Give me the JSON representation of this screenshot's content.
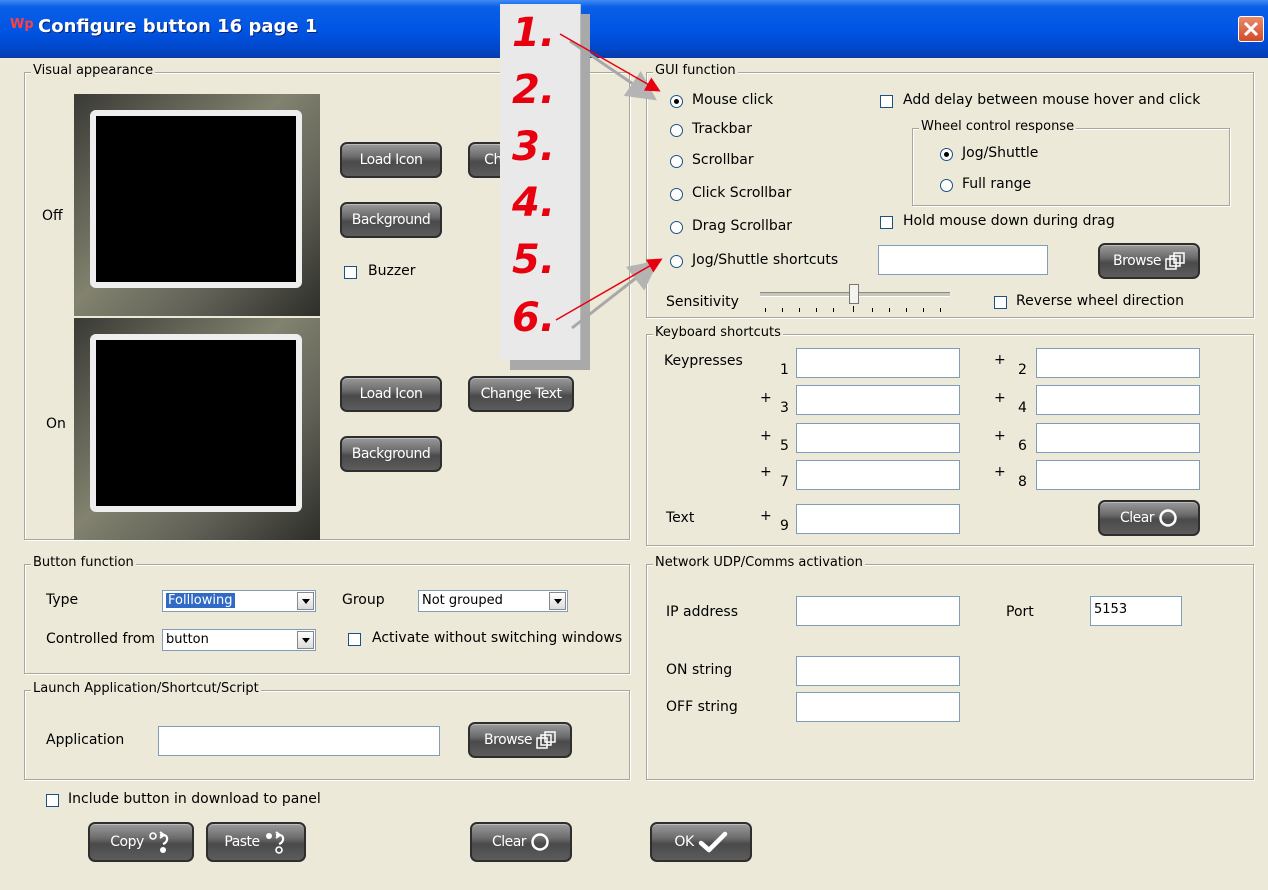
{
  "window": {
    "title": "Configure button 16 page 1",
    "app_icon": "Wp"
  },
  "annotations": [
    "1.",
    "2.",
    "3.",
    "4.",
    "5.",
    "6."
  ],
  "visual_appearance": {
    "label": "Visual appearance",
    "off_label": "Off",
    "on_label": "On",
    "load_icon_label": "Load Icon",
    "change_text_label": "Change Text",
    "change_text_partial": "Ch",
    "background_label": "Background",
    "buzzer_label": "Buzzer"
  },
  "gui_function": {
    "label": "GUI function",
    "options": [
      "Mouse click",
      "Trackbar",
      "Scrollbar",
      "Click Scrollbar",
      "Drag Scrollbar",
      "Jog/Shuttle shortcuts"
    ],
    "selected": "Mouse click",
    "add_delay_label": "Add delay between mouse hover and click",
    "wheel_group_label": "Wheel control response",
    "wheel_options": [
      "Jog/Shuttle",
      "Full range"
    ],
    "wheel_selected": "Jog/Shuttle",
    "hold_mouse_label": "Hold mouse down during drag",
    "browse_label": "Browse",
    "sensitivity_label": "Sensitivity",
    "sensitivity_value": 0.45,
    "reverse_wheel_label": "Reverse wheel direction"
  },
  "keyboard_shortcuts": {
    "label": "Keyboard shortcuts",
    "keypresses_label": "Keypresses",
    "text_label": "Text",
    "plus": "+",
    "numbers": [
      "1",
      "2",
      "3",
      "4",
      "5",
      "6",
      "7",
      "8",
      "9"
    ],
    "clear_label": "Clear"
  },
  "button_function": {
    "label": "Button function",
    "type_label": "Type",
    "type_value": "Folllowing",
    "group_label": "Group",
    "group_value": "Not grouped",
    "controlled_from_label": "Controlled from",
    "controlled_from_value": "button",
    "activate_label": "Activate without switching windows"
  },
  "network": {
    "label": "Network UDP/Comms activation",
    "ip_label": "IP address",
    "ip_value": "",
    "port_label": "Port",
    "port_value": "5153",
    "on_string_label": "ON string",
    "off_string_label": "OFF string"
  },
  "launch": {
    "label": "Launch Application/Shortcut/Script",
    "application_label": "Application",
    "browse_label": "Browse"
  },
  "footer": {
    "include_label": "Include button in download to panel",
    "copy_label": "Copy",
    "paste_label": "Paste",
    "clear_label": "Clear",
    "ok_label": "OK"
  }
}
